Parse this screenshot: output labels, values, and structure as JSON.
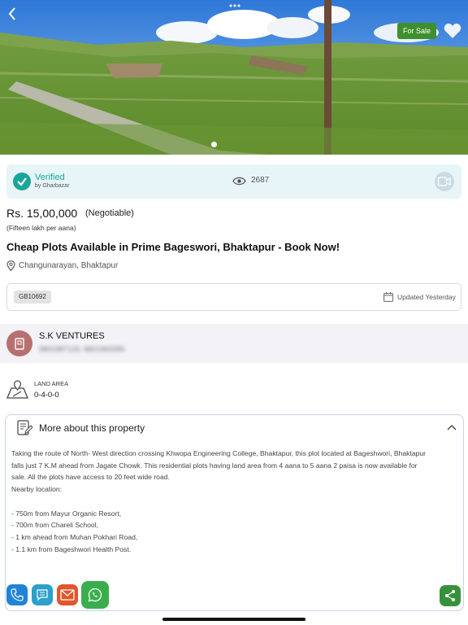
{
  "hero": {
    "badge": "For Sale",
    "icons": {
      "back": "chevron-left-icon",
      "more": "more-dots-icon",
      "favorite": "heart-icon"
    }
  },
  "verified": {
    "title": "Verified",
    "subtitle": "by Gharbazar",
    "views": "2687",
    "icons": {
      "check": "check-circle-icon",
      "eye": "eye-icon",
      "video": "video-camera-icon"
    }
  },
  "listing": {
    "price": "Rs. 15,00,000",
    "negotiable": "(Negotiable)",
    "price_words": "(Fifteen lakh per aana)",
    "title": "Cheap Plots Available in Prime Bageswori, Bhaktapur - Book Now!",
    "location": "Changunarayan, Bhaktapur",
    "id": "GB10692",
    "updated": "Updated Yesterday"
  },
  "agent": {
    "name": "S.K VENTURES",
    "phones": "9801987133, 9801969289"
  },
  "land_area": {
    "label": "LAND AREA",
    "value": "0-4-0-0"
  },
  "about": {
    "title": "More about this property",
    "lines": [
      "Taking the route of North- West direction crossing  Khwopa Engineering College, Bhaktapur, this plot located at Bageshwori, Bhaktapur",
      "falls just  7 K.M ahead  from Jagate Chowk. This residential plots having land area  from 4 aana  to 5 aana 2 paisa is now available for",
      "sale. All the plots have access to 20 feet wide road.",
      "Nearby location:",
      "",
      "- 750m from Mayur Organic Resort,",
      "- 700m from Chareli School,",
      "- 1 km ahead from Muhan Pokhari Road,",
      "- 1.1 km from Bageshwori Health Post."
    ]
  },
  "colors": {
    "sale_badge": "#3f8f2e",
    "verified_bg": "#e7f5f8",
    "verified_accent": "#1aa59a",
    "call": "#2183d6",
    "chat": "#2ba1cc",
    "mail": "#e3552a",
    "whatsapp": "#3aae4d",
    "share": "#36923a"
  },
  "actions": {
    "icons": [
      "phone-icon",
      "chat-icon",
      "mail-icon",
      "whatsapp-icon",
      "share-icon"
    ]
  }
}
